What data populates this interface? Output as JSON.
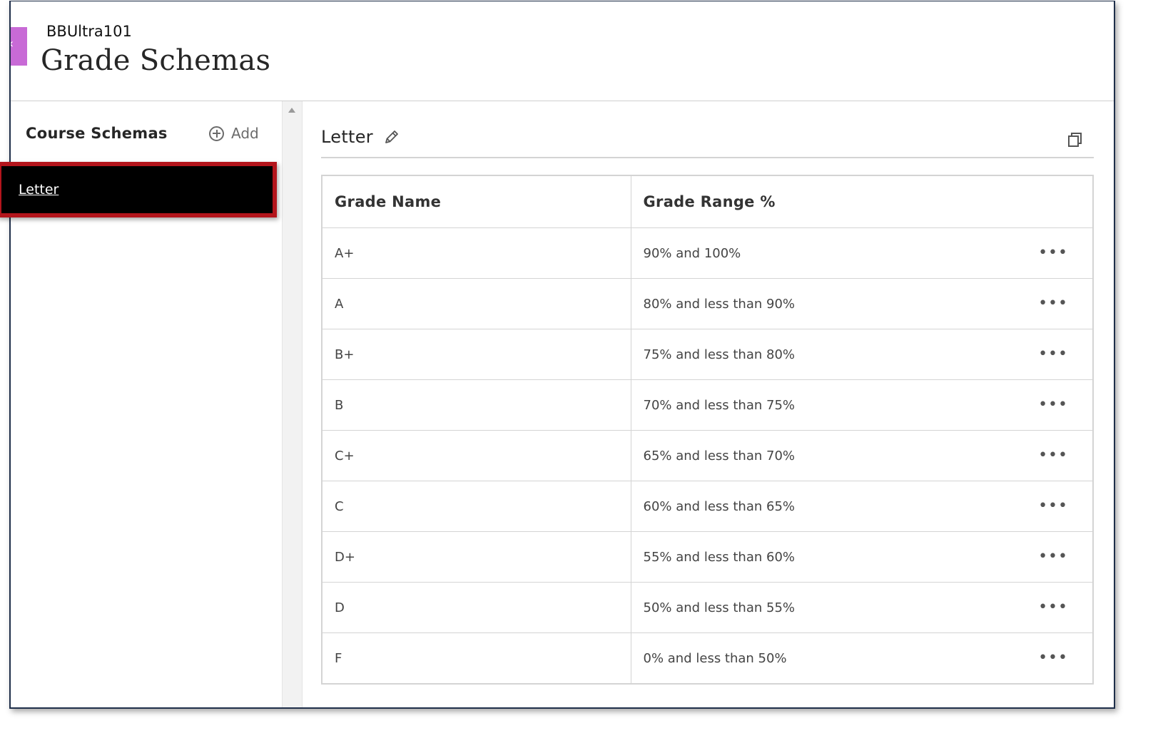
{
  "header": {
    "course_name": "BBUltra101",
    "page_title": "Grade Schemas",
    "back_icon": "chevron-left-icon"
  },
  "sidebar": {
    "heading": "Course Schemas",
    "add_label": "Add",
    "items": [
      {
        "label": "Letter",
        "selected": true
      }
    ]
  },
  "detail": {
    "title": "Letter",
    "edit_icon": "pencil-icon",
    "copy_icon": "copy-icon",
    "columns": [
      "Grade Name",
      "Grade Range %"
    ],
    "rows": [
      {
        "grade": "A+",
        "range": "90% and 100%"
      },
      {
        "grade": "A",
        "range": "80% and less than 90%"
      },
      {
        "grade": "B+",
        "range": "75% and less than 80%"
      },
      {
        "grade": "B",
        "range": "70% and less than 75%"
      },
      {
        "grade": "C+",
        "range": "65% and less than 70%"
      },
      {
        "grade": "C",
        "range": "60% and less than 65%"
      },
      {
        "grade": "D+",
        "range": "55% and less than 60%"
      },
      {
        "grade": "D",
        "range": "50% and less than 55%"
      },
      {
        "grade": "F",
        "range": "0% and less than 50%"
      }
    ],
    "row_menu_glyph": "•••"
  },
  "colors": {
    "accent_tab": "#c86ad6",
    "highlight_border": "#b3151c",
    "selected_bg": "#000000"
  }
}
